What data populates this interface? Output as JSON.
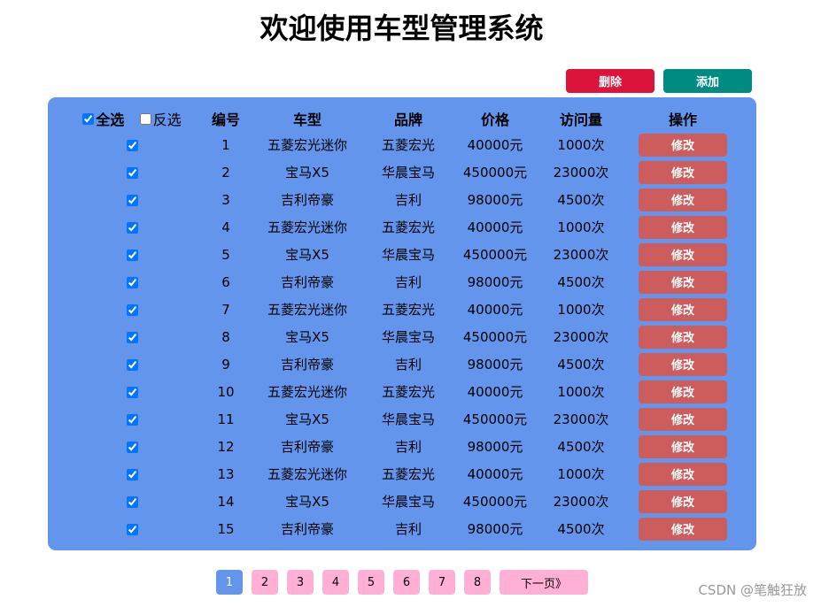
{
  "page": {
    "title": "欢迎使用车型管理系统"
  },
  "toolbar": {
    "delete_label": "删除",
    "add_label": "添加"
  },
  "colors": {
    "delete": "#dc143c",
    "add": "#008b83",
    "panel": "#6495ed",
    "edit": "#cd5c5c",
    "pager": "#ffb0d4",
    "pager_active": "#6495ed"
  },
  "table": {
    "select_all_label": "全选",
    "inverse_label": "反选",
    "select_all_checked": true,
    "inverse_checked": false,
    "headers": [
      "编号",
      "车型",
      "品牌",
      "价格",
      "访问量",
      "操作"
    ],
    "edit_label": "修改",
    "rows": [
      {
        "checked": true,
        "id": "1",
        "model": "五菱宏光迷你",
        "brand": "五菱宏光",
        "price": "40000元",
        "visits": "1000次"
      },
      {
        "checked": true,
        "id": "2",
        "model": "宝马X5",
        "brand": "华晨宝马",
        "price": "450000元",
        "visits": "23000次"
      },
      {
        "checked": true,
        "id": "3",
        "model": "吉利帝豪",
        "brand": "吉利",
        "price": "98000元",
        "visits": "4500次"
      },
      {
        "checked": true,
        "id": "4",
        "model": "五菱宏光迷你",
        "brand": "五菱宏光",
        "price": "40000元",
        "visits": "1000次"
      },
      {
        "checked": true,
        "id": "5",
        "model": "宝马X5",
        "brand": "华晨宝马",
        "price": "450000元",
        "visits": "23000次"
      },
      {
        "checked": true,
        "id": "6",
        "model": "吉利帝豪",
        "brand": "吉利",
        "price": "98000元",
        "visits": "4500次"
      },
      {
        "checked": true,
        "id": "7",
        "model": "五菱宏光迷你",
        "brand": "五菱宏光",
        "price": "40000元",
        "visits": "1000次"
      },
      {
        "checked": true,
        "id": "8",
        "model": "宝马X5",
        "brand": "华晨宝马",
        "price": "450000元",
        "visits": "23000次"
      },
      {
        "checked": true,
        "id": "9",
        "model": "吉利帝豪",
        "brand": "吉利",
        "price": "98000元",
        "visits": "4500次"
      },
      {
        "checked": true,
        "id": "10",
        "model": "五菱宏光迷你",
        "brand": "五菱宏光",
        "price": "40000元",
        "visits": "1000次"
      },
      {
        "checked": true,
        "id": "11",
        "model": "宝马X5",
        "brand": "华晨宝马",
        "price": "450000元",
        "visits": "23000次"
      },
      {
        "checked": true,
        "id": "12",
        "model": "吉利帝豪",
        "brand": "吉利",
        "price": "98000元",
        "visits": "4500次"
      },
      {
        "checked": true,
        "id": "13",
        "model": "五菱宏光迷你",
        "brand": "五菱宏光",
        "price": "40000元",
        "visits": "1000次"
      },
      {
        "checked": true,
        "id": "14",
        "model": "宝马X5",
        "brand": "华晨宝马",
        "price": "450000元",
        "visits": "23000次"
      },
      {
        "checked": true,
        "id": "15",
        "model": "吉利帝豪",
        "brand": "吉利",
        "price": "98000元",
        "visits": "4500次"
      }
    ]
  },
  "pagination": {
    "pages": [
      "1",
      "2",
      "3",
      "4",
      "5",
      "6",
      "7",
      "8"
    ],
    "current": "1",
    "next_label": "下一页》"
  },
  "watermark": "CSDN @笔触狂放"
}
